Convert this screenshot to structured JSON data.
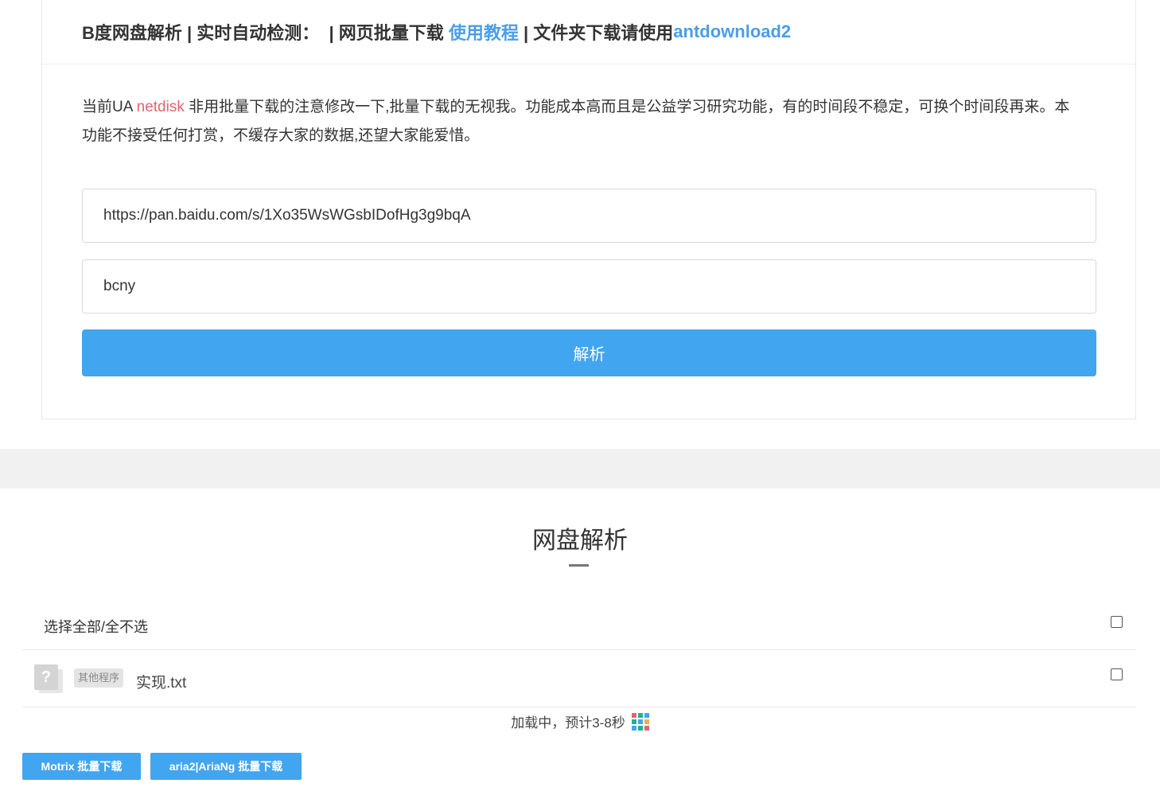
{
  "header": {
    "prefix": "B度网盘解析 | 实时自动检测：  | 网页批量下载 ",
    "tutorial_link": "使用教程",
    "middle": " | 文件夹下载请使用",
    "antdownload_link": "antdownload2"
  },
  "notice": {
    "prefix": "当前UA ",
    "ua": "netdisk",
    "text": " 非用批量下载的注意修改一下,批量下载的无视我。功能成本高而且是公益学习研究功能，有的时间段不稳定，可换个时间段再来。本功能不接受任何打赏，不缓存大家的数据,还望大家能爱惜。"
  },
  "form": {
    "url_value": "https://pan.baidu.com/s/1Xo35WsWGsbIDofHg3g9bqA",
    "code_value": "bcny",
    "parse_label": "解析"
  },
  "result": {
    "title": "网盘解析",
    "select_all_label": "选择全部/全不选",
    "files": [
      {
        "icon": "?",
        "tag": "其他程序",
        "name": "实现.txt"
      }
    ],
    "loading_text": "加载中，预计3-8秒",
    "loading_icon_colors": [
      "#e8626c",
      "#1ab394",
      "#42a5ef",
      "#1ab394",
      "#42a5ef",
      "#f0ad4e",
      "#42a5ef",
      "#1ab394",
      "#e8626c"
    ]
  },
  "buttons": {
    "motrix": "Motrix 批量下载",
    "aria2": "aria2|AriaNg 批量下载"
  },
  "colors": {
    "accent": "#42a5ef",
    "link": "#4a9ee8",
    "ua_red": "#e8626c"
  }
}
